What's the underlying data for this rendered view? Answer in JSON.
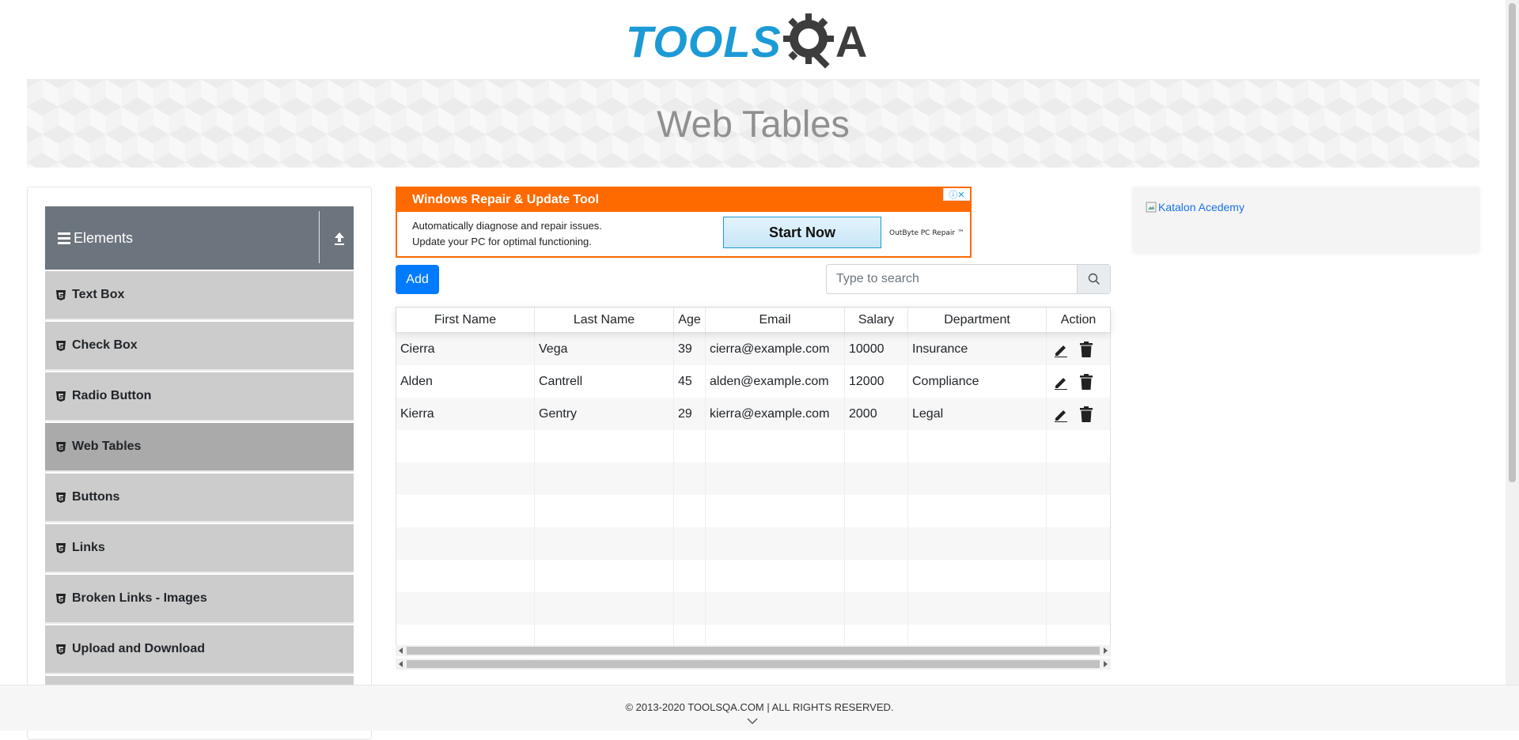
{
  "logo": {
    "part1": "TOOLS",
    "part2": "A",
    "alt": "TOOLSQA"
  },
  "banner": {
    "title": "Web Tables"
  },
  "sidebar": {
    "group": "Elements",
    "items": [
      {
        "label": "Text Box"
      },
      {
        "label": "Check Box"
      },
      {
        "label": "Radio Button"
      },
      {
        "label": "Web Tables",
        "active": true
      },
      {
        "label": "Buttons"
      },
      {
        "label": "Links"
      },
      {
        "label": "Broken Links - Images"
      },
      {
        "label": "Upload and Download"
      }
    ]
  },
  "ad": {
    "title": "Windows Repair & Update Tool",
    "line1": "Automatically diagnose and repair issues.",
    "line2": "Update your PC for optimal functioning.",
    "cta": "Start Now",
    "brand": "OutByte PC Repair ™",
    "choices": "ⓘ✕"
  },
  "toolbar": {
    "add_label": "Add",
    "search_placeholder": "Type to search"
  },
  "table": {
    "headers": [
      "First Name",
      "Last Name",
      "Age",
      "Email",
      "Salary",
      "Department",
      "Action"
    ],
    "rows": [
      [
        "Cierra",
        "Vega",
        "39",
        "cierra@example.com",
        "10000",
        "Insurance"
      ],
      [
        "Alden",
        "Cantrell",
        "45",
        "alden@example.com",
        "12000",
        "Compliance"
      ],
      [
        "Kierra",
        "Gentry",
        "29",
        "kierra@example.com",
        "2000",
        "Legal"
      ]
    ]
  },
  "right_ad": {
    "alt": "Katalon Acedemy"
  },
  "footer": {
    "copyright": "© 2013-2020 TOOLSQA.COM | ALL RIGHTS RESERVED."
  },
  "colors": {
    "brand_blue": "#1c9ad6",
    "primary": "#007bff",
    "ad_orange": "#ff6a00",
    "sidebar_header": "#6c757d"
  },
  "icons": {
    "hamburger": "hamburger-icon",
    "collapse": "collapse-arrow-icon",
    "menu": "html5-icon",
    "search": "search-icon",
    "edit": "pencil-icon",
    "delete": "trash-icon"
  }
}
